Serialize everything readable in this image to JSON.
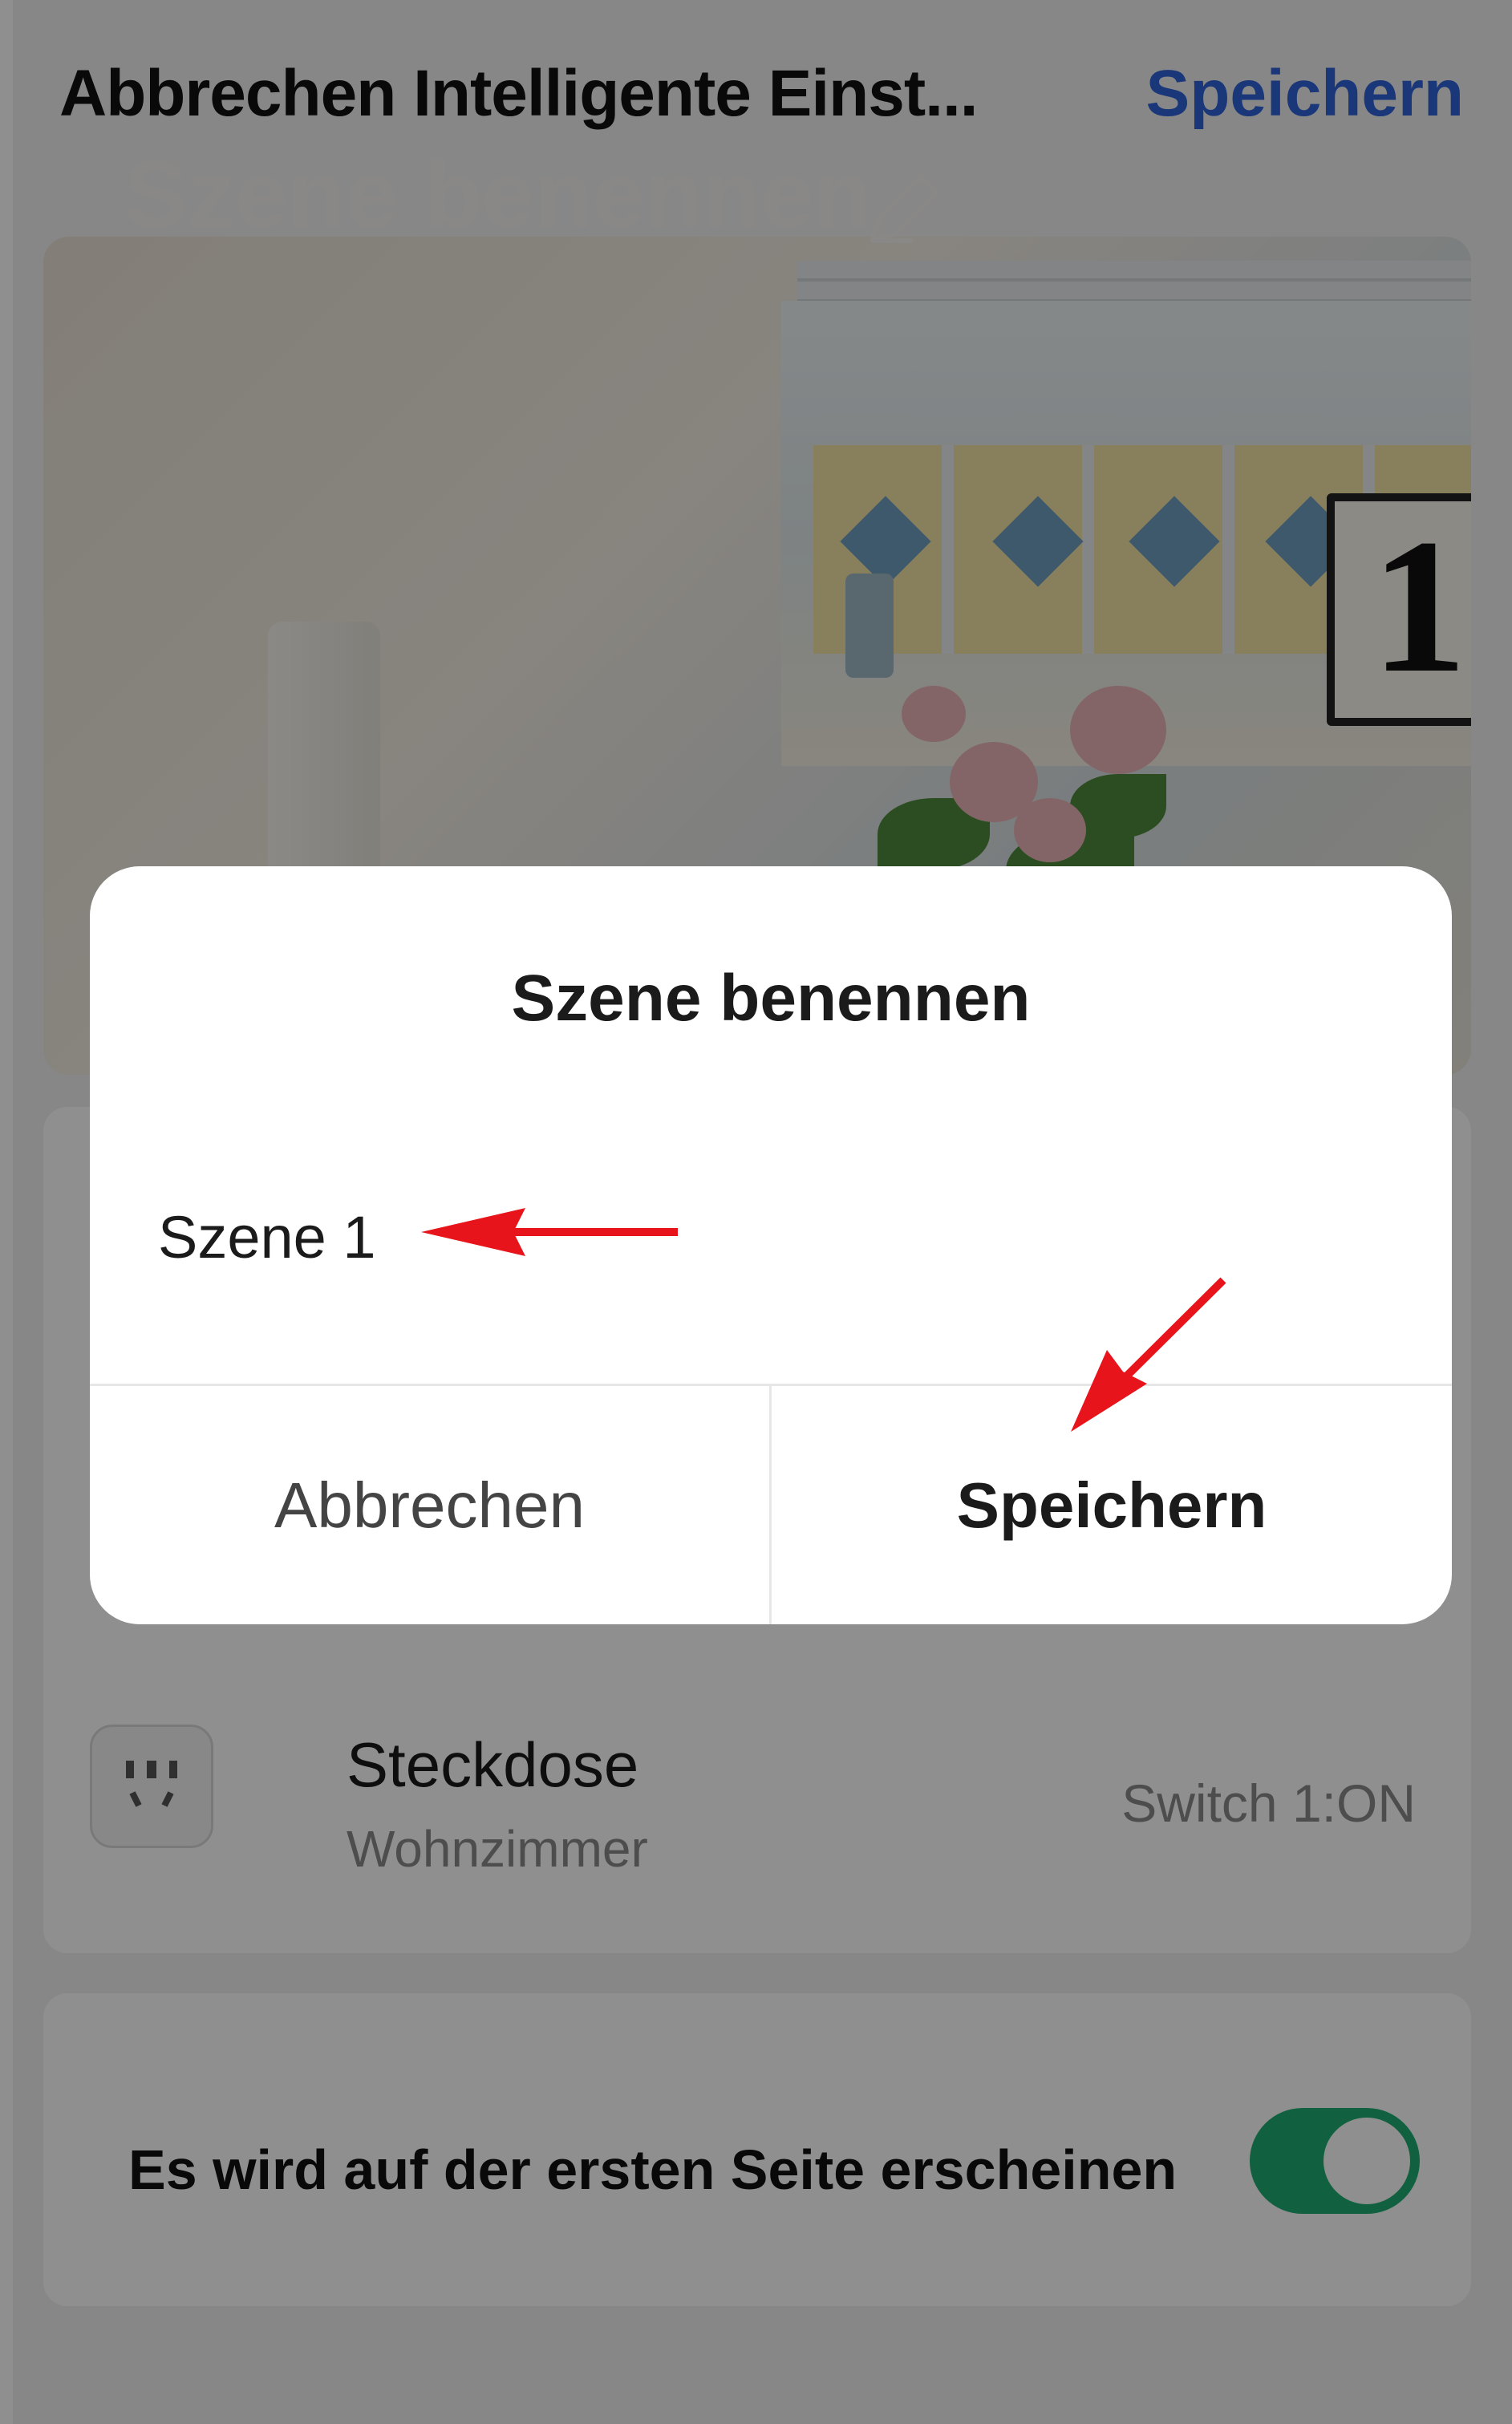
{
  "topbar": {
    "cancel_title": "Abbrechen Intelligente Einst...",
    "save_label": "Speichern"
  },
  "cover": {
    "title": "Szene benennen",
    "sign_number": "1"
  },
  "device": {
    "name": "Steckdose",
    "room": "Wohnzimmer",
    "state": "Switch 1:ON",
    "icon": "socket-icon"
  },
  "home_option": {
    "label": "Es wird auf der ersten Seite erscheinen",
    "enabled": true
  },
  "dialog": {
    "title": "Szene benennen",
    "input_value": "Szene 1",
    "cancel_label": "Abbrechen",
    "save_label": "Speichern"
  },
  "colors": {
    "accent": "#2f62d8",
    "toggle_on": "#1fad74",
    "annotation_arrow": "#e8141b"
  }
}
